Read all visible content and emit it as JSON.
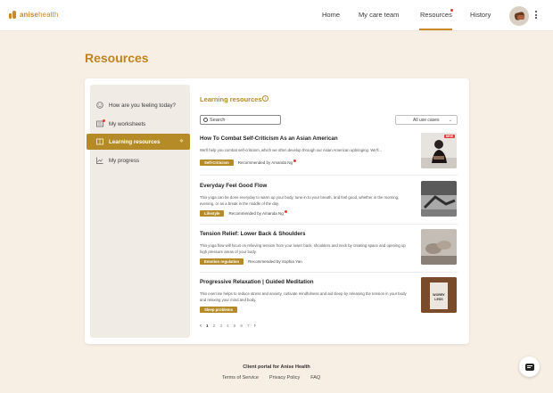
{
  "app": {
    "logo_text_bold": "anise",
    "logo_text_light": "health",
    "brand_color": "#c8892a",
    "accent_color": "#b58b27"
  },
  "nav": {
    "home": "Home",
    "care_team": "My care team",
    "resources": "Resources",
    "history": "History"
  },
  "page": {
    "title": "Resources"
  },
  "sidebar": {
    "items": [
      {
        "label": "How are you feeling today?",
        "icon": "smiley-icon"
      },
      {
        "label": "My worksheets",
        "icon": "worksheet-icon"
      },
      {
        "label": "Learning resources",
        "icon": "book-icon",
        "active": true
      },
      {
        "label": "My progress",
        "icon": "chart-icon"
      }
    ]
  },
  "main": {
    "header": "Learning resources",
    "search_placeholder": "Search",
    "filter_value": "All use cases",
    "items": [
      {
        "title": "How To Combat Self-Criticism As an Asian American",
        "desc": "We'll help you combat self-criticism, which we often develop through our Asian American upbringing. We'll...",
        "tag": "Self-Criticism",
        "rec": "Recommended by Amanda Ng",
        "badge": "NEW"
      },
      {
        "title": "Everyday Feel Good Flow",
        "desc": "This yoga can be done everyday to warm up your body, tune-in to your breath, and feel good, whether in the morning, evening, or as a break in the middle of the day.",
        "tag": "Lifestyle",
        "rec": "Recommended by Amanda Ng"
      },
      {
        "title": "Tension Relief: Lower Back & Shoulders",
        "desc": "This yoga flow will focus on relieving tension from your lower back, shoulders and neck by creating space and opening up high pressure areas of your body.",
        "tag": "Emotion regulation",
        "rec": "Recommended by Sophia Yan"
      },
      {
        "title": "Progressive Relaxation | Guided Meditation",
        "desc": "This exercise helps to reduce stress and anxiety, cultivate mindfulness and aid sleep by releasing the tension in your body and relaxing your mind and body.",
        "tag": "Sleep problems",
        "thumb_text": "WORRY LESS"
      }
    ],
    "pagination": {
      "prev": "‹",
      "pages": [
        "1",
        "2",
        "3",
        "4",
        "5",
        "6",
        "7"
      ],
      "next": "›"
    }
  },
  "footer": {
    "title": "Client portal for Anise Health",
    "links": [
      "Terms of Service",
      "Privacy Policy",
      "FAQ"
    ]
  }
}
